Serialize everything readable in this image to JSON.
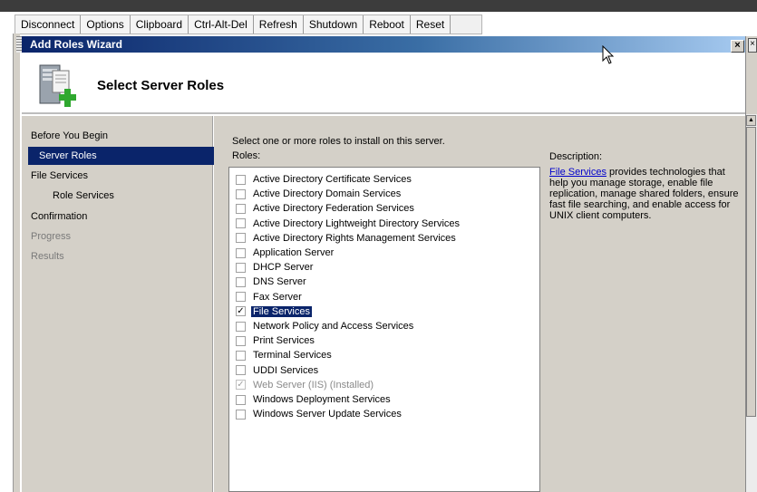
{
  "toolbar": [
    "Disconnect",
    "Options",
    "Clipboard",
    "Ctrl-Alt-Del",
    "Refresh",
    "Shutdown",
    "Reboot",
    "Reset"
  ],
  "window": {
    "title": "Add Roles Wizard",
    "close": "×"
  },
  "header": {
    "title": "Select Server Roles",
    "icon": "server-add-icon"
  },
  "nav": [
    {
      "label": "Before You Begin",
      "state": "normal"
    },
    {
      "label": "Server Roles",
      "state": "active"
    },
    {
      "label": "File Services",
      "state": "normal"
    },
    {
      "label": "Role Services",
      "state": "sub"
    },
    {
      "label": "Confirmation",
      "state": "normal"
    },
    {
      "label": "Progress",
      "state": "disabled"
    },
    {
      "label": "Results",
      "state": "disabled"
    }
  ],
  "content": {
    "instruction": "Select one or more roles to install on this server.",
    "roles_label": "Roles:",
    "description_label": "Description:",
    "description_link": "File Services",
    "description_text": " provides technologies that help you manage storage, enable file replication, manage shared folders, ensure fast file searching, and enable access for UNIX client computers."
  },
  "roles": [
    {
      "label": "Active Directory Certificate Services",
      "checked": false,
      "disabled": false,
      "selected": false
    },
    {
      "label": "Active Directory Domain Services",
      "checked": false,
      "disabled": false,
      "selected": false
    },
    {
      "label": "Active Directory Federation Services",
      "checked": false,
      "disabled": false,
      "selected": false
    },
    {
      "label": "Active Directory Lightweight Directory Services",
      "checked": false,
      "disabled": false,
      "selected": false
    },
    {
      "label": "Active Directory Rights Management Services",
      "checked": false,
      "disabled": false,
      "selected": false
    },
    {
      "label": "Application Server",
      "checked": false,
      "disabled": false,
      "selected": false
    },
    {
      "label": "DHCP Server",
      "checked": false,
      "disabled": false,
      "selected": false
    },
    {
      "label": "DNS Server",
      "checked": false,
      "disabled": false,
      "selected": false
    },
    {
      "label": "Fax Server",
      "checked": false,
      "disabled": false,
      "selected": false
    },
    {
      "label": "File Services",
      "checked": true,
      "disabled": false,
      "selected": true
    },
    {
      "label": "Network Policy and Access Services",
      "checked": false,
      "disabled": false,
      "selected": false
    },
    {
      "label": "Print Services",
      "checked": false,
      "disabled": false,
      "selected": false
    },
    {
      "label": "Terminal Services",
      "checked": false,
      "disabled": false,
      "selected": false
    },
    {
      "label": "UDDI Services",
      "checked": false,
      "disabled": false,
      "selected": false
    },
    {
      "label": "Web Server (IIS)  (Installed)",
      "checked": true,
      "disabled": true,
      "selected": false
    },
    {
      "label": "Windows Deployment Services",
      "checked": false,
      "disabled": false,
      "selected": false
    },
    {
      "label": "Windows Server Update Services",
      "checked": false,
      "disabled": false,
      "selected": false
    }
  ],
  "colors": {
    "nav_active": "#0a246a",
    "panel": "#d4d0c8",
    "link": "#0000cc"
  }
}
